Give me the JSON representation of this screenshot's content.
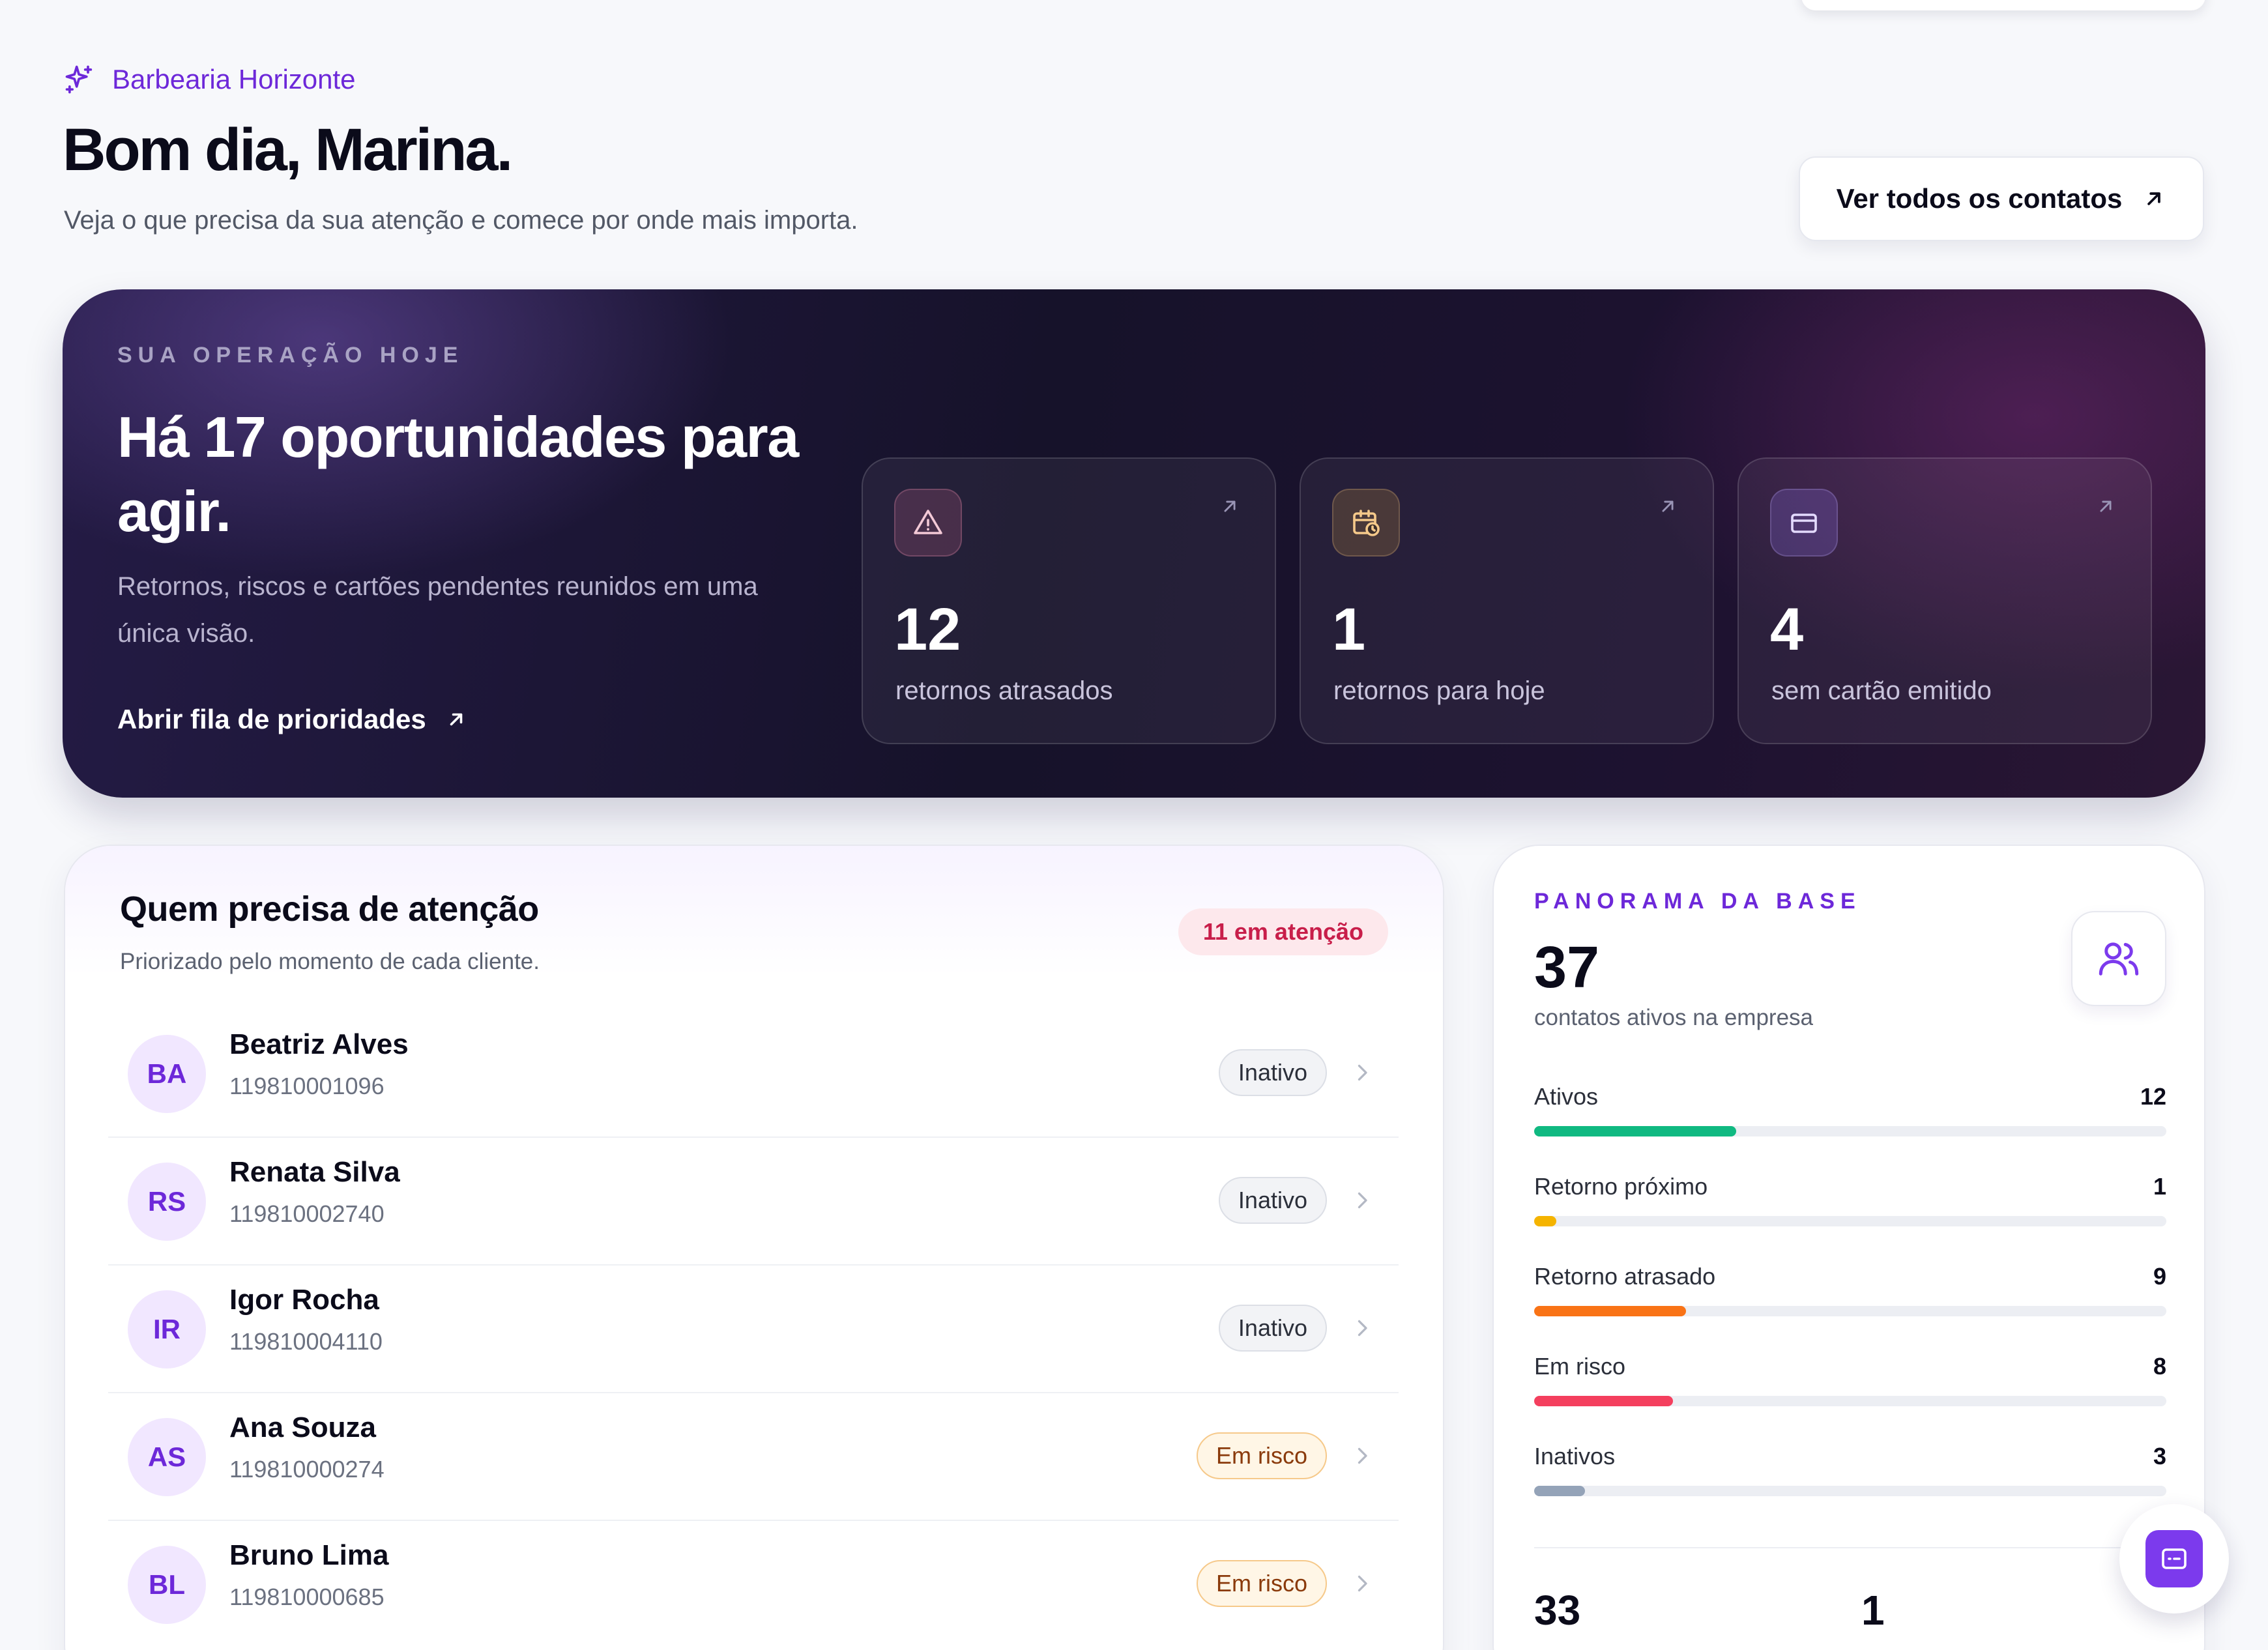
{
  "header": {
    "brand": "Barbearia Horizonte",
    "greeting": "Bom dia, Marina.",
    "subtitle": "Veja o que precisa da sua atenção e comece por onde mais importa.",
    "contacts_button": "Ver todos os contatos"
  },
  "hero": {
    "eyebrow": "SUA OPERAÇÃO HOJE",
    "title": "Há 17 oportunidades para agir.",
    "description": "Retornos, riscos e cartões pendentes reunidos em uma única visão.",
    "link": "Abrir fila de prioridades",
    "stats": [
      {
        "icon": "warning-icon",
        "value": "12",
        "label": "retornos atrasados",
        "accent": "#f3c9d6"
      },
      {
        "icon": "calendar-clock-icon",
        "value": "1",
        "label": "retornos para hoje",
        "accent": "#f5c98a"
      },
      {
        "icon": "credit-card-icon",
        "value": "4",
        "label": "sem cartão emitido",
        "accent": "#d9cdfb"
      }
    ]
  },
  "attention": {
    "title": "Quem precisa de atenção",
    "subtitle": "Priorizado pelo momento de cada cliente.",
    "badge": "11 em atenção",
    "rows": [
      {
        "initials": "BA",
        "name": "Beatriz Alves",
        "phone": "119810001096",
        "status": "Inativo"
      },
      {
        "initials": "RS",
        "name": "Renata Silva",
        "phone": "119810002740",
        "status": "Inativo"
      },
      {
        "initials": "IR",
        "name": "Igor Rocha",
        "phone": "119810004110",
        "status": "Inativo"
      },
      {
        "initials": "AS",
        "name": "Ana Souza",
        "phone": "119810000274",
        "status": "Em risco"
      },
      {
        "initials": "BL",
        "name": "Bruno Lima",
        "phone": "119810000685",
        "status": "Em risco"
      }
    ]
  },
  "overview": {
    "eyebrow": "PANORAMA DA BASE",
    "total": "37",
    "total_label": "contatos ativos na empresa",
    "metrics": [
      {
        "label": "Ativos",
        "value": "12",
        "fraction": 0.32,
        "color": "#10b981"
      },
      {
        "label": "Retorno próximo",
        "value": "1",
        "fraction": 0.035,
        "color": "#f5b400"
      },
      {
        "label": "Retorno atrasado",
        "value": "9",
        "fraction": 0.24,
        "color": "#f97316"
      },
      {
        "label": "Em risco",
        "value": "8",
        "fraction": 0.22,
        "color": "#f43f5e"
      },
      {
        "label": "Inativos",
        "value": "3",
        "fraction": 0.08,
        "color": "#94a3b8"
      }
    ],
    "bottom_a": "33",
    "bottom_b": "1"
  },
  "colors": {
    "accent": "#6d28d9",
    "fab": "#7c3aed"
  }
}
